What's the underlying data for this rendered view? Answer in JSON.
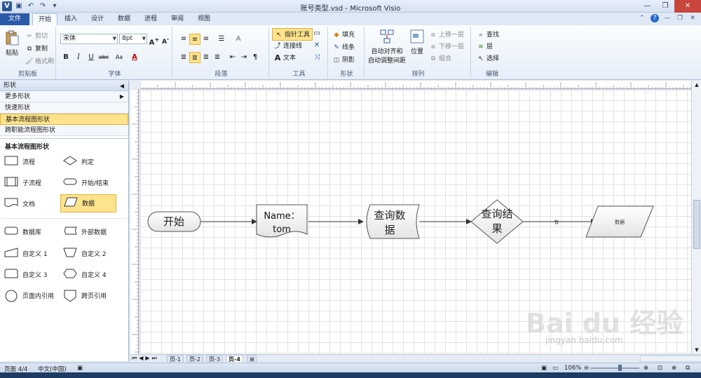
{
  "window": {
    "title": "账号类型.vsd  -  Microsoft Visio",
    "app_icon": "V"
  },
  "ribbon_tabs": [
    "文件",
    "开始",
    "插入",
    "设计",
    "数据",
    "进程",
    "审阅",
    "视图"
  ],
  "ribbon": {
    "clipboard": {
      "paste": "粘贴",
      "cut": "剪切",
      "copy": "复制",
      "format_painter": "格式刷",
      "name": "剪贴板"
    },
    "font": {
      "family": "宋体",
      "size": "8pt",
      "name": "字体",
      "bold": "B",
      "italic": "I",
      "underline": "U",
      "strike": "abc",
      "case": "Aa",
      "color": "A"
    },
    "paragraph": {
      "name": "段落"
    },
    "tools": {
      "pointer": "指针工具",
      "connector": "连接线",
      "text": "文本",
      "name": "工具"
    },
    "shape": {
      "fill": "填充",
      "line": "线条",
      "shadow": "阴影",
      "name": "形状"
    },
    "arrange": {
      "auto_align": "自动对齐和",
      "auto_space": "自动调整间距",
      "position": "位置",
      "bring_forward": "上移一层",
      "send_backward": "下移一层",
      "group": "组合",
      "name": "排列"
    },
    "editing": {
      "find": "查找",
      "layers": "层",
      "select": "选择",
      "name": "编辑"
    }
  },
  "shapes_panel": {
    "header": "形状",
    "rows": [
      "更多形状",
      "快速形状",
      "基本流程图形状",
      "跨职能流程图形状"
    ],
    "selected_row": 2,
    "stencil_title": "基本流程图形状",
    "items": [
      "流程",
      "判定",
      "子流程",
      "开始/结束",
      "文档",
      "数据",
      "数据库",
      "外部数据",
      "自定义 1",
      "自定义 2",
      "自定义 3",
      "自定义 4",
      "页面内引用",
      "跨页引用"
    ],
    "selected_item": 5
  },
  "diagram": {
    "start": "开始",
    "document_line1": "Name：",
    "document_line2": "tom",
    "storage_line1": "查询数",
    "storage_line2": "据",
    "decision_line1": "查询结",
    "decision_line2": "果",
    "edge_label": "有",
    "data": "数据"
  },
  "page_tabs": [
    "页-1",
    "页-2",
    "页-3",
    "页-4"
  ],
  "active_page": 3,
  "status": {
    "page": "页面 4/4",
    "language": "中文(中国)",
    "zoom": "106%"
  },
  "watermark": {
    "main": "Bai du 经验",
    "sub": "jingyan.baidu.com"
  }
}
